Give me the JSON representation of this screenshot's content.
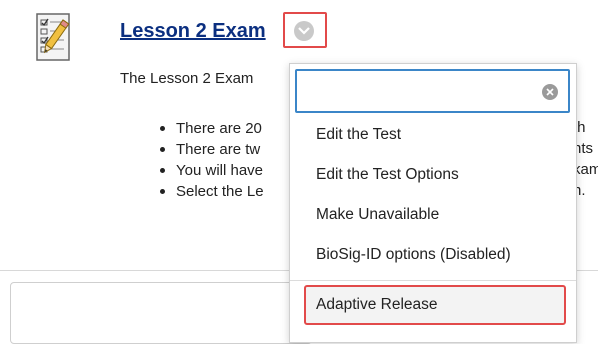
{
  "content_item": {
    "title": "Lesson 2 Exam",
    "description": "The Lesson 2 Exam",
    "bullets": [
      "There are 20",
      "There are tw",
      "You will have",
      "Select the Le"
    ],
    "right_fragments": [
      "th",
      "nts",
      "kam",
      "n."
    ]
  },
  "menu": {
    "search_value": "",
    "items": [
      "Edit the Test",
      "Edit the Test Options",
      "Make Unavailable",
      "BioSig-ID options (Disabled)",
      "Adaptive Release"
    ]
  },
  "colors": {
    "title_link": "#0b2f80",
    "highlight_outline": "#e24a4a",
    "search_focus": "#3b86c8"
  },
  "icons": {
    "test": "test-document-pencil-icon",
    "menu_toggle": "chevron-down-icon",
    "clear": "clear-icon"
  }
}
